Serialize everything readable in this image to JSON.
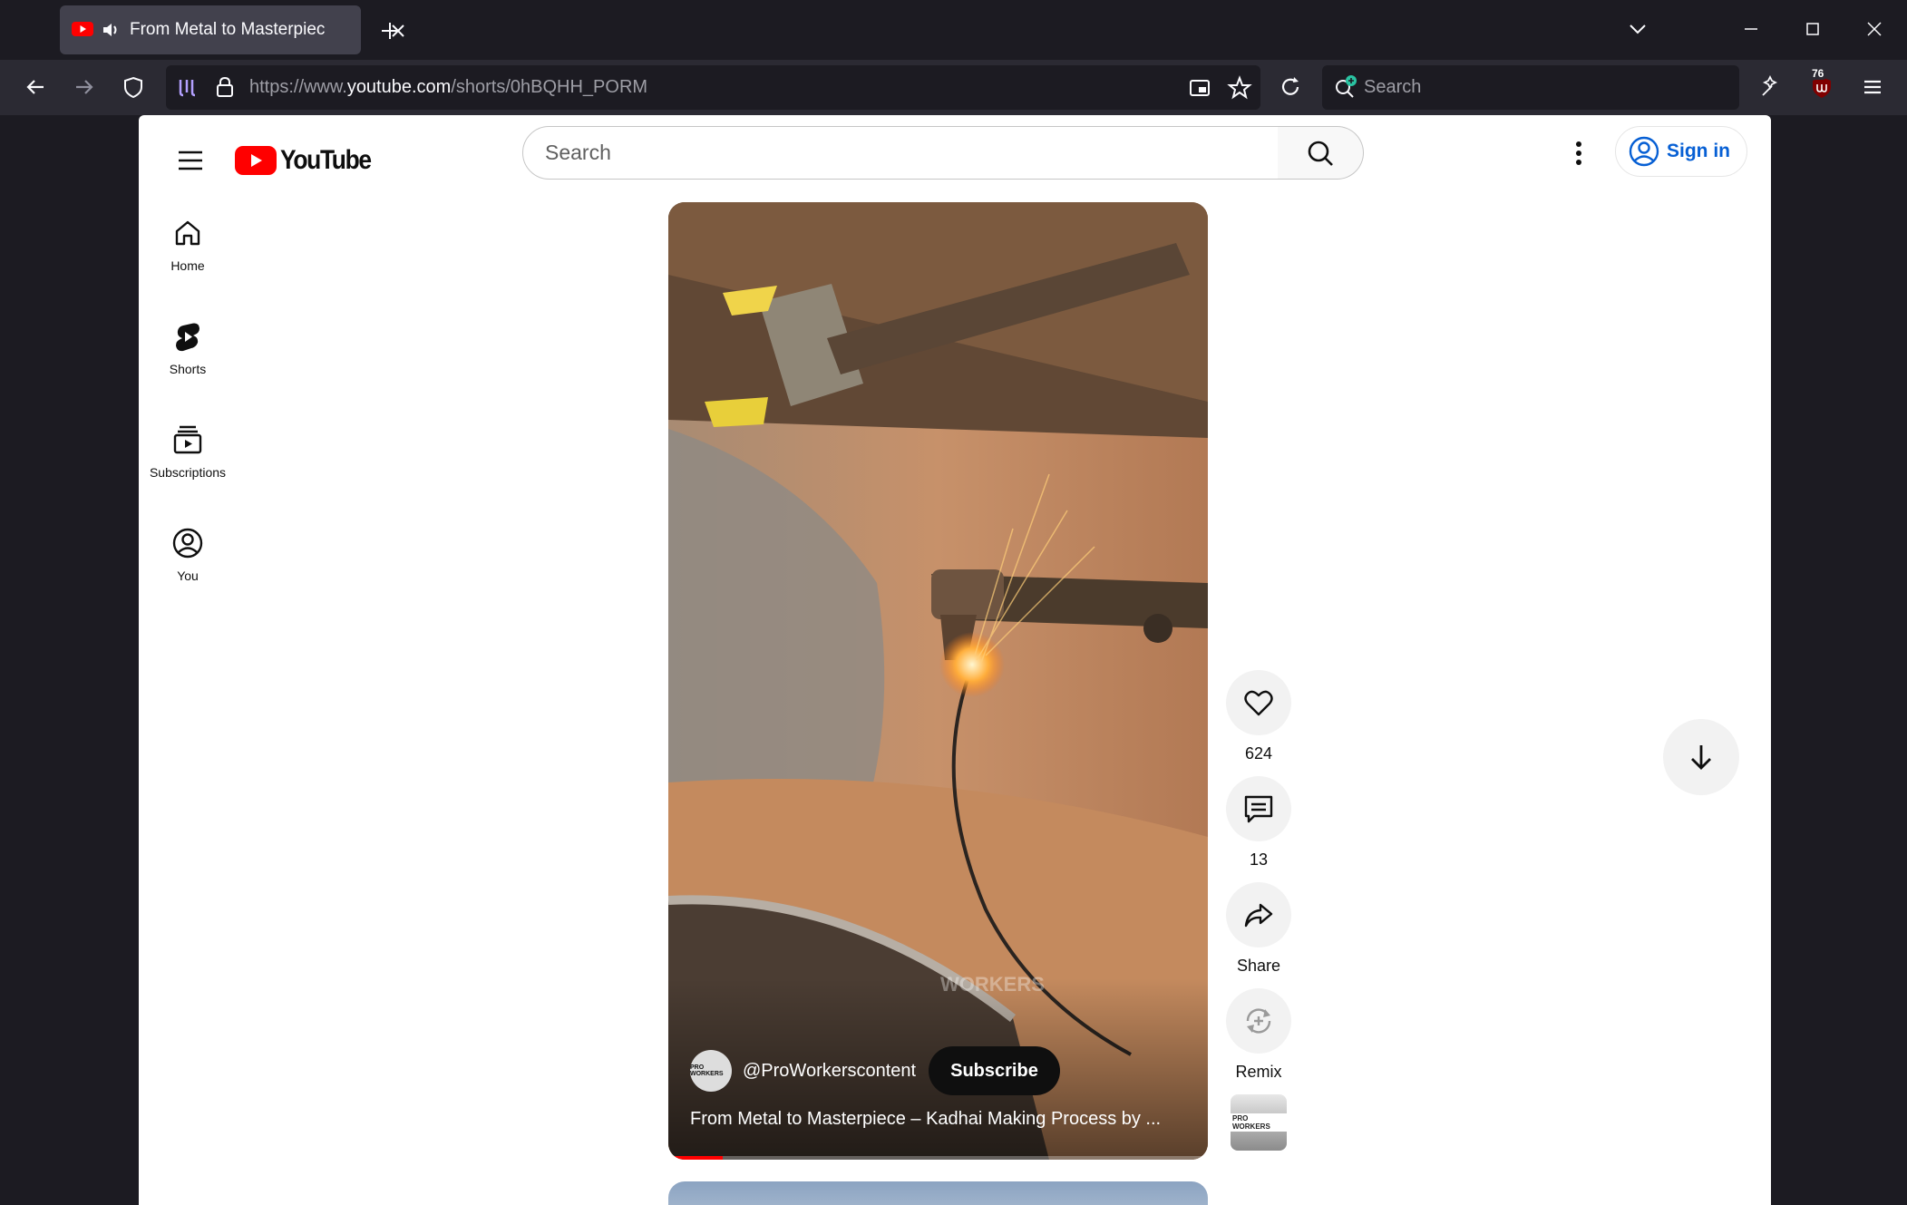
{
  "browser": {
    "tab_title": "From Metal to Masterpiece",
    "url_prefix": "https://www.",
    "url_domain": "youtube.com",
    "url_path": "/shorts/0hBQHH_PORM",
    "search_placeholder": "Search",
    "extension_badge": "76"
  },
  "youtube": {
    "logo_text": "YouTube",
    "search_placeholder": "Search",
    "sign_in": "Sign in",
    "sidebar": [
      {
        "label": "Home",
        "icon": "home-icon"
      },
      {
        "label": "Shorts",
        "icon": "shorts-icon"
      },
      {
        "label": "Subscriptions",
        "icon": "subscriptions-icon"
      },
      {
        "label": "You",
        "icon": "you-icon"
      }
    ],
    "short": {
      "channel": "@ProWorkerscontent",
      "channel_avatar_text": "PRO WORKERS",
      "subscribe": "Subscribe",
      "title": "From Metal to Masterpiece – Kadhai Making Process by ...",
      "watermark": "WORKERS",
      "progress_fraction": 0.1
    },
    "actions": {
      "likes": "624",
      "comments": "13",
      "share": "Share",
      "remix": "Remix"
    }
  },
  "colors": {
    "youtube_red": "#ff0000",
    "link_blue": "#065fd4"
  }
}
